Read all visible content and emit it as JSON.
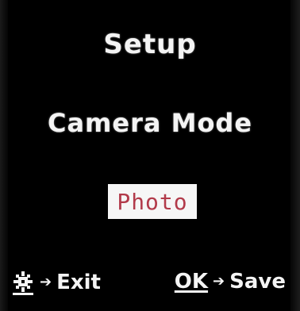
{
  "screen": {
    "title": "Setup",
    "menu_item": "Camera Mode",
    "selected_value": "Photo"
  },
  "footer": {
    "exit_icon": "menu-key-icon",
    "arrow_icon": "arrow-right-icon",
    "exit_label": "Exit",
    "ok_key": "OK",
    "save_label": "Save"
  },
  "colors": {
    "background": "#000000",
    "text": "#f4f4f4",
    "highlight_bg": "#f6f6f6",
    "highlight_text": "#b23a4a"
  }
}
